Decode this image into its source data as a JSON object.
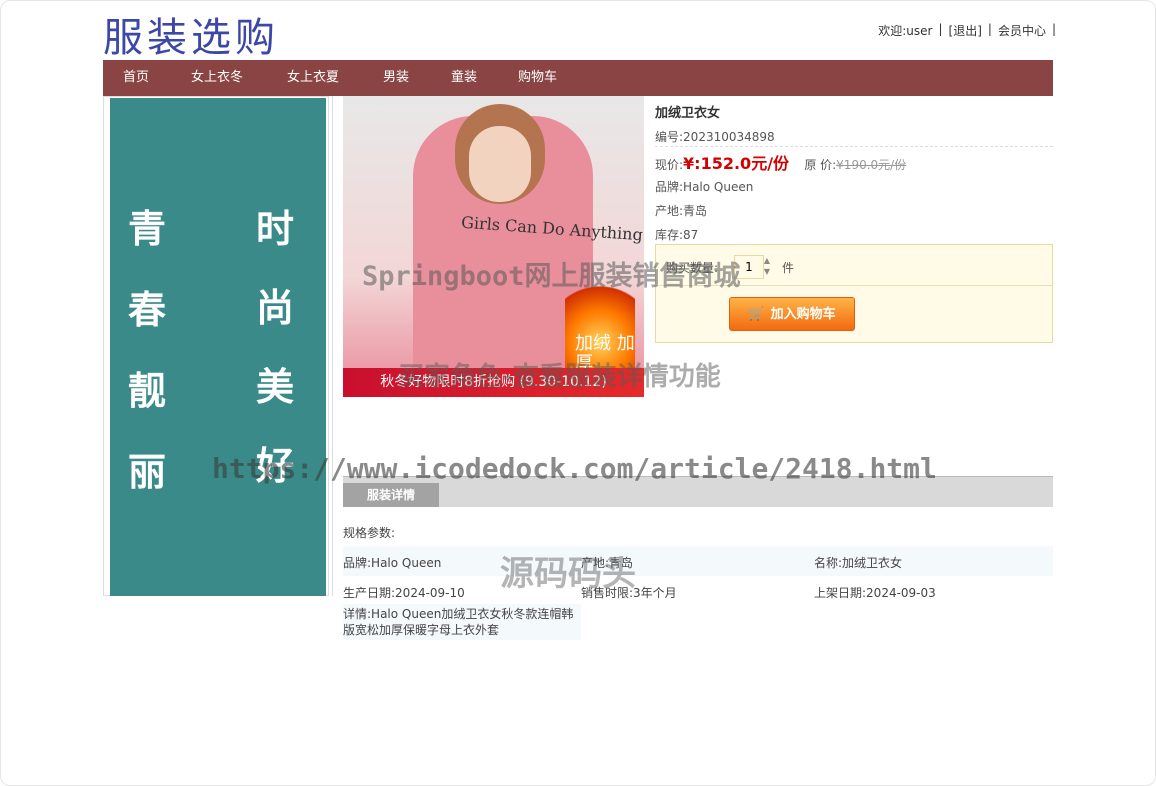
{
  "header": {
    "logo": "服装选购",
    "welcome": "欢迎:user",
    "logout": "[退出]",
    "member_center": "会员中心",
    "sep": "|"
  },
  "nav": {
    "items": [
      "首页",
      "女上衣冬",
      "女上衣夏",
      "男装",
      "童装",
      "购物车"
    ]
  },
  "sidebar": {
    "banner_col1": [
      "青",
      "春",
      "靓",
      "丽"
    ],
    "banner_col2": [
      "时",
      "尚",
      "美",
      "好"
    ]
  },
  "product": {
    "image": {
      "print_text": "Girls Can Do Anything",
      "badge": "加绒 加厚",
      "promo": "秋冬好物限时8折抢购 (9.30-10.12)"
    },
    "name": "加绒卫衣女",
    "code": "编号:202310034898",
    "price_label": "现价:",
    "price": "¥:152.0元/份",
    "orig_label": "原 价:",
    "orig_price": "¥190.0元/份",
    "brand": "品牌:Halo Queen",
    "origin": "产地:青岛",
    "stock": "库存:87",
    "qty_label": "购买数量:",
    "qty_value": "1",
    "qty_unit": "件",
    "add_to_cart": "加入购物车"
  },
  "detail": {
    "tab": "服装详情",
    "spec_title": "规格参数:",
    "row1": [
      "品牌:Halo Queen",
      "产地:青岛",
      "名称:加绒卫衣女"
    ],
    "row2": [
      "生产日期:2024-09-10",
      "销售时限:3年个月",
      "上架日期:2024-09-03"
    ],
    "desc": "详情:Halo Queen加绒卫衣女秋冬款连帽韩版宽松加厚保暖字母上衣外套"
  },
  "watermarks": {
    "w1": "Springboot网上服装销售商城",
    "w2": "买家角色-查看服装详情功能",
    "w3": "https://www.icodedock.com/article/2418.html",
    "w4": "源码码头"
  },
  "colors": {
    "nav_bg": "#8b4444",
    "banner_bg": "#3a8a8a",
    "price": "#d40000",
    "cart_button": "#f26a10"
  }
}
